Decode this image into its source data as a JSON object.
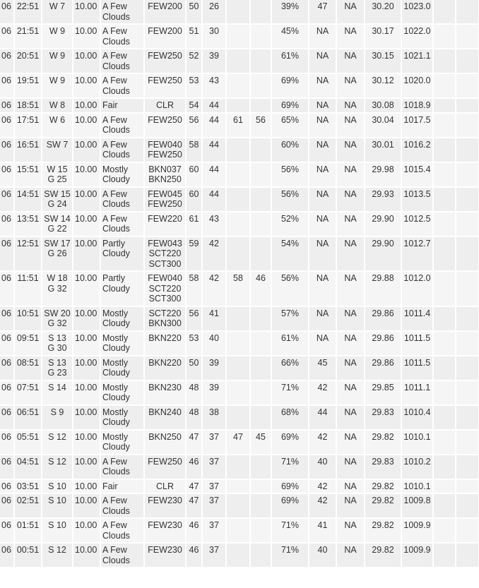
{
  "columns_hint": [],
  "rows": [
    [
      "06",
      "22:51",
      "W 7",
      "10.00",
      "A Few Clouds",
      "FEW200",
      "50",
      "26",
      "",
      "",
      "39%",
      "47",
      "NA",
      "30.20",
      "1023.0",
      "",
      "",
      ""
    ],
    [
      "06",
      "21:51",
      "W 9",
      "10.00",
      "A Few Clouds",
      "FEW200",
      "51",
      "30",
      "",
      "",
      "45%",
      "NA",
      "NA",
      "30.17",
      "1022.0",
      "",
      "",
      ""
    ],
    [
      "06",
      "20:51",
      "W 9",
      "10.00",
      "A Few Clouds",
      "FEW250",
      "52",
      "39",
      "",
      "",
      "61%",
      "NA",
      "NA",
      "30.15",
      "1021.1",
      "",
      "",
      ""
    ],
    [
      "06",
      "19:51",
      "W 9",
      "10.00",
      "A Few Clouds",
      "FEW250",
      "53",
      "43",
      "",
      "",
      "69%",
      "NA",
      "NA",
      "30.12",
      "1020.0",
      "",
      "",
      ""
    ],
    [
      "06",
      "18:51",
      "W 8",
      "10.00",
      "Fair",
      "CLR",
      "54",
      "44",
      "",
      "",
      "69%",
      "NA",
      "NA",
      "30.08",
      "1018.9",
      "",
      "",
      ""
    ],
    [
      "06",
      "17:51",
      "W 6",
      "10.00",
      "A Few Clouds",
      "FEW250",
      "56",
      "44",
      "61",
      "56",
      "65%",
      "NA",
      "NA",
      "30.04",
      "1017.5",
      "",
      "",
      ""
    ],
    [
      "06",
      "16:51",
      "SW 7",
      "10.00",
      "A Few Clouds",
      "FEW040\nFEW250",
      "58",
      "44",
      "",
      "",
      "60%",
      "NA",
      "NA",
      "30.01",
      "1016.2",
      "",
      "",
      ""
    ],
    [
      "06",
      "15:51",
      "W 15 G 25",
      "10.00",
      "Mostly Cloudy",
      "BKN037\nBKN250",
      "60",
      "44",
      "",
      "",
      "56%",
      "NA",
      "NA",
      "29.98",
      "1015.4",
      "",
      "",
      ""
    ],
    [
      "06",
      "14:51",
      "SW 15 G 24",
      "10.00",
      "A Few Clouds",
      "FEW045\nFEW250",
      "60",
      "44",
      "",
      "",
      "56%",
      "NA",
      "NA",
      "29.93",
      "1013.5",
      "",
      "",
      ""
    ],
    [
      "06",
      "13:51",
      "SW 14 G 22",
      "10.00",
      "A Few Clouds",
      "FEW220",
      "61",
      "43",
      "",
      "",
      "52%",
      "NA",
      "NA",
      "29.90",
      "1012.5",
      "",
      "",
      ""
    ],
    [
      "06",
      "12:51",
      "SW 17 G 26",
      "10.00",
      "Partly Cloudy",
      "FEW043\nSCT220\nSCT300",
      "59",
      "42",
      "",
      "",
      "54%",
      "NA",
      "NA",
      "29.90",
      "1012.7",
      "",
      "",
      ""
    ],
    [
      "06",
      "11:51",
      "W 18 G 32",
      "10.00",
      "Partly Cloudy",
      "FEW040\nSCT220\nSCT300",
      "58",
      "42",
      "58",
      "46",
      "56%",
      "NA",
      "NA",
      "29.88",
      "1012.0",
      "",
      "",
      ""
    ],
    [
      "06",
      "10:51",
      "SW 20 G 32",
      "10.00",
      "Mostly Cloudy",
      "SCT220\nBKN300",
      "56",
      "41",
      "",
      "",
      "57%",
      "NA",
      "NA",
      "29.86",
      "1011.4",
      "",
      "",
      ""
    ],
    [
      "06",
      "09:51",
      "S 13 G 30",
      "10.00",
      "Mostly Cloudy",
      "BKN220",
      "53",
      "40",
      "",
      "",
      "61%",
      "NA",
      "NA",
      "29.86",
      "1011.5",
      "",
      "",
      ""
    ],
    [
      "06",
      "08:51",
      "S 13 G 23",
      "10.00",
      "Mostly Cloudy",
      "BKN220",
      "50",
      "39",
      "",
      "",
      "66%",
      "45",
      "NA",
      "29.86",
      "1011.5",
      "",
      "",
      ""
    ],
    [
      "06",
      "07:51",
      "S 14",
      "10.00",
      "Mostly Cloudy",
      "BKN230",
      "48",
      "39",
      "",
      "",
      "71%",
      "42",
      "NA",
      "29.85",
      "1011.1",
      "",
      "",
      ""
    ],
    [
      "06",
      "06:51",
      "S 9",
      "10.00",
      "Mostly Cloudy",
      "BKN240",
      "48",
      "38",
      "",
      "",
      "68%",
      "44",
      "NA",
      "29.83",
      "1010.4",
      "",
      "",
      ""
    ],
    [
      "06",
      "05:51",
      "S 12",
      "10.00",
      "Mostly Cloudy",
      "BKN250",
      "47",
      "37",
      "47",
      "45",
      "69%",
      "42",
      "NA",
      "29.82",
      "1010.1",
      "",
      "",
      ""
    ],
    [
      "06",
      "04:51",
      "S 12",
      "10.00",
      "A Few Clouds",
      "FEW250",
      "46",
      "37",
      "",
      "",
      "71%",
      "40",
      "NA",
      "29.83",
      "1010.2",
      "",
      "",
      ""
    ],
    [
      "06",
      "03:51",
      "S 10",
      "10.00",
      "Fair",
      "CLR",
      "47",
      "37",
      "",
      "",
      "69%",
      "42",
      "NA",
      "29.82",
      "1010.1",
      "",
      "",
      ""
    ],
    [
      "06",
      "02:51",
      "S 10",
      "10.00",
      "A Few Clouds",
      "FEW230",
      "47",
      "37",
      "",
      "",
      "69%",
      "42",
      "NA",
      "29.82",
      "1009.8",
      "",
      "",
      ""
    ],
    [
      "06",
      "01:51",
      "S 10",
      "10.00",
      "A Few Clouds",
      "FEW230",
      "46",
      "37",
      "",
      "",
      "71%",
      "41",
      "NA",
      "29.82",
      "1009.9",
      "",
      "",
      ""
    ],
    [
      "06",
      "00:51",
      "S 12",
      "10.00",
      "A Few Clouds",
      "FEW230",
      "46",
      "37",
      "",
      "",
      "71%",
      "40",
      "NA",
      "29.82",
      "1009.9",
      "",
      "",
      ""
    ]
  ]
}
